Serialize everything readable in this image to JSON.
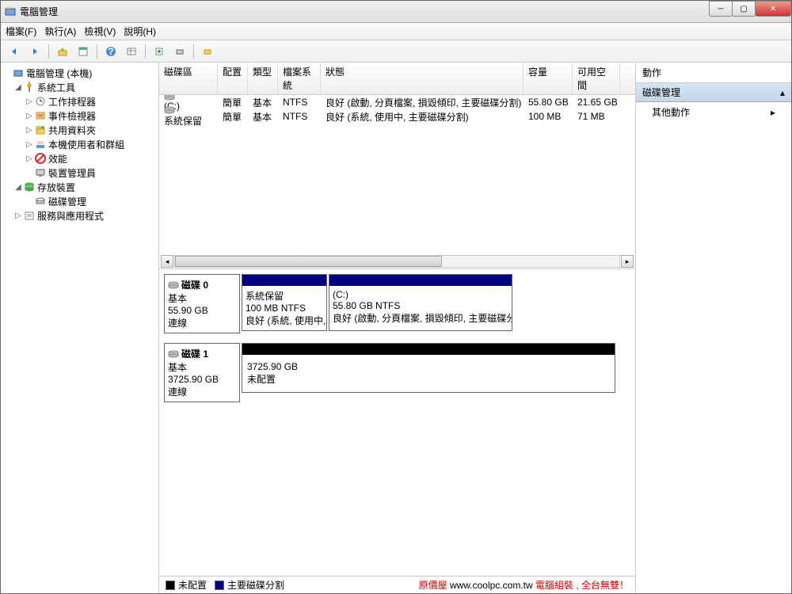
{
  "window": {
    "title": "電腦管理"
  },
  "menu": {
    "file": "檔案(F)",
    "action": "執行(A)",
    "view": "檢視(V)",
    "help": "說明(H)"
  },
  "tree": {
    "root": "電腦管理 (本機)",
    "systools": "系統工具",
    "scheduler": "工作排程器",
    "eventviewer": "事件檢視器",
    "shared": "共用資料夾",
    "users": "本機使用者和群組",
    "perf": "效能",
    "devmgr": "裝置管理員",
    "storage": "存放裝置",
    "diskmgmt": "磁碟管理",
    "services": "服務與應用程式"
  },
  "listcols": {
    "volume": "磁碟區",
    "layout": "配置",
    "type": "類型",
    "fs": "檔案系統",
    "status": "狀態",
    "capacity": "容量",
    "free": "可用空間"
  },
  "volumes": [
    {
      "name": "(C:)",
      "layout": "簡單",
      "type": "基本",
      "fs": "NTFS",
      "status": "良好 (啟動, 分頁檔案, 損毀傾印, 主要磁碟分割)",
      "capacity": "55.80 GB",
      "free": "21.65 GB"
    },
    {
      "name": "系統保留",
      "layout": "簡單",
      "type": "基本",
      "fs": "NTFS",
      "status": "良好 (系統, 使用中, 主要磁碟分割)",
      "capacity": "100 MB",
      "free": "71 MB"
    }
  ],
  "disks": [
    {
      "name": "磁碟 0",
      "type": "基本",
      "size": "55.90 GB",
      "state": "連線",
      "parts": [
        {
          "label": "系統保留",
          "l2": "100 MB NTFS",
          "l3": "良好 (系統, 使用中, 主要磁碟分割)",
          "widthpx": 108,
          "header": "navy"
        },
        {
          "label": "(C:)",
          "l2": "55.80 GB NTFS",
          "l3": "良好 (啟動, 分頁檔案, 損毀傾印, 主要磁碟分割)",
          "widthpx": 232,
          "header": "navy"
        }
      ]
    },
    {
      "name": "磁碟 1",
      "type": "基本",
      "size": "3725.90 GB",
      "state": "連線",
      "parts": [
        {
          "label": "",
          "l2": "3725.90 GB",
          "l3": "未配置",
          "widthpx": 472,
          "header": "black"
        }
      ]
    }
  ],
  "legend": {
    "unalloc": "未配置",
    "primary": "主要磁碟分割",
    "ad1": "原價屋 ",
    "adurl": "www.coolpc.com.tw",
    "ad2": " 電腦組裝 , 全台無雙！"
  },
  "actions": {
    "title": "動作",
    "group": "磁碟管理",
    "more": "其他動作"
  }
}
